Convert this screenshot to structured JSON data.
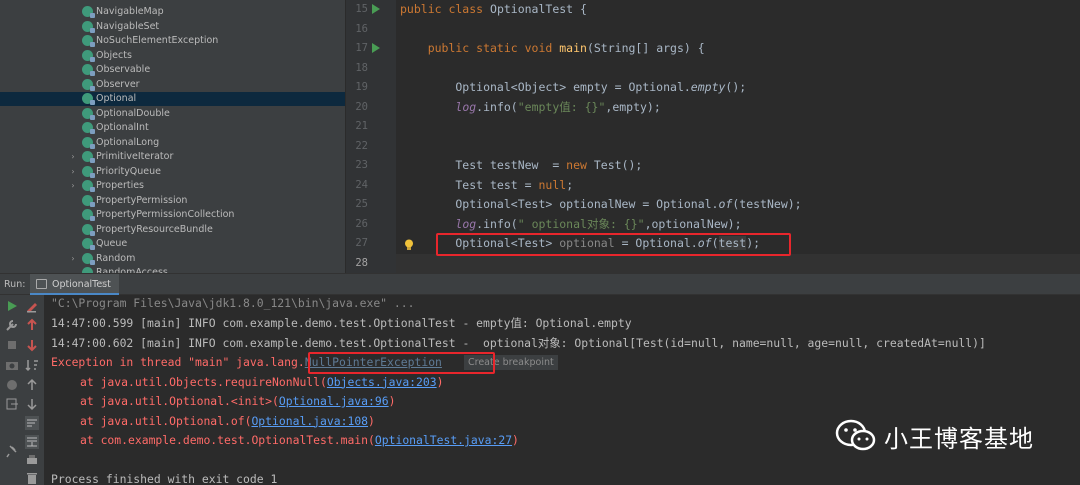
{
  "project_tree": {
    "items": [
      {
        "label": "NavigableMap",
        "arrow": "",
        "selected": false
      },
      {
        "label": "NavigableSet",
        "arrow": "",
        "selected": false
      },
      {
        "label": "NoSuchElementException",
        "arrow": "",
        "selected": false
      },
      {
        "label": "Objects",
        "arrow": "",
        "selected": false
      },
      {
        "label": "Observable",
        "arrow": "",
        "selected": false
      },
      {
        "label": "Observer",
        "arrow": "",
        "selected": false
      },
      {
        "label": "Optional",
        "arrow": "",
        "selected": true
      },
      {
        "label": "OptionalDouble",
        "arrow": "",
        "selected": false
      },
      {
        "label": "OptionalInt",
        "arrow": "",
        "selected": false
      },
      {
        "label": "OptionalLong",
        "arrow": "",
        "selected": false
      },
      {
        "label": "PrimitiveIterator",
        "arrow": "›",
        "selected": false
      },
      {
        "label": "PriorityQueue",
        "arrow": "›",
        "selected": false
      },
      {
        "label": "Properties",
        "arrow": "›",
        "selected": false
      },
      {
        "label": "PropertyPermission",
        "arrow": "",
        "selected": false
      },
      {
        "label": "PropertyPermissionCollection",
        "arrow": "",
        "selected": false
      },
      {
        "label": "PropertyResourceBundle",
        "arrow": "",
        "selected": false
      },
      {
        "label": "Queue",
        "arrow": "",
        "selected": false
      },
      {
        "label": "Random",
        "arrow": "›",
        "selected": false
      },
      {
        "label": "RandomAccess",
        "arrow": "",
        "selected": false
      }
    ]
  },
  "editor": {
    "line_numbers": [
      "15",
      "16",
      "17",
      "18",
      "19",
      "20",
      "21",
      "22",
      "23",
      "24",
      "25",
      "26",
      "27",
      "28"
    ],
    "code": {
      "l15_a": "public class ",
      "l15_b": "OptionalTest {",
      "l17_a": "    public static void ",
      "l17_b": "main",
      "l17_c": "(String[] args) {",
      "l19_a": "        Optional<Object> empty = Optional.",
      "l19_b": "empty",
      "l19_c": "();",
      "l20_a": "        ",
      "l20_b": "log",
      "l20_c": ".info(",
      "l20_d": "\"empty值: {}\"",
      "l20_e": ",empty);",
      "l23_a": "        Test testNew  = ",
      "l23_b": "new ",
      "l23_c": "Test();",
      "l24_a": "        Test test = ",
      "l24_b": "null",
      "l24_c": ";",
      "l25_a": "        Optional<Test> optionalNew = Optional.",
      "l25_b": "of",
      "l25_c": "(testNew);",
      "l26_a": "        ",
      "l26_b": "log",
      "l26_c": ".info(",
      "l26_d": "\" optional对象: {}\"",
      "l26_e": ",optionalNew);",
      "l27_a": "        Optional<Test> ",
      "l27_b": "optional",
      "l27_c": " = Optional.",
      "l27_d": "of",
      "l27_e": "(",
      "l27_f": "test",
      "l27_g": ");"
    }
  },
  "run_panel": {
    "label": "Run:",
    "tab_title": "OptionalTest",
    "tab_close": "×",
    "console": {
      "cmd": "\"C:\\Program Files\\Java\\jdk1.8.0_121\\bin\\java.exe\" ...",
      "log1": "14:47:00.599 [main] INFO com.example.demo.test.OptionalTest - empty值: Optional.empty",
      "log2": "14:47:00.602 [main] INFO com.example.demo.test.OptionalTest -  optional对象: Optional[Test(id=null, name=null, age=null, createdAt=null)]",
      "exc_prefix": "Exception in thread \"main\" java.lang.",
      "exc_name": "NullPointerException",
      "tooltip": "Create breakpoint",
      "st1_a": "at java.util.Objects.requireNonNull(",
      "st1_b": "Objects.java:203",
      "st1_c": ")",
      "st2_a": "at java.util.Optional.<init>(",
      "st2_b": "Optional.java:96",
      "st2_c": ")",
      "st3_a": "at java.util.Optional.of(",
      "st3_b": "Optional.java:108",
      "st3_c": ")",
      "st4_a": "at com.example.demo.test.OptionalTest.main(",
      "st4_b": "OptionalTest.java:27",
      "st4_c": ")",
      "exit": "Process finished with exit code 1"
    }
  },
  "watermark": {
    "text": "小王博客基地"
  },
  "colors": {
    "editor_bg": "#2b2b2b",
    "panel_bg": "#3c3f41",
    "keyword": "#cc7832",
    "string": "#6a8759",
    "error": "#ff6b68",
    "link": "#589df6",
    "annotation_red": "#e8262c"
  },
  "icons": {
    "tree_class": "class-icon",
    "run_gutter": "run-triangle-icon",
    "intention": "lightbulb-icon"
  }
}
